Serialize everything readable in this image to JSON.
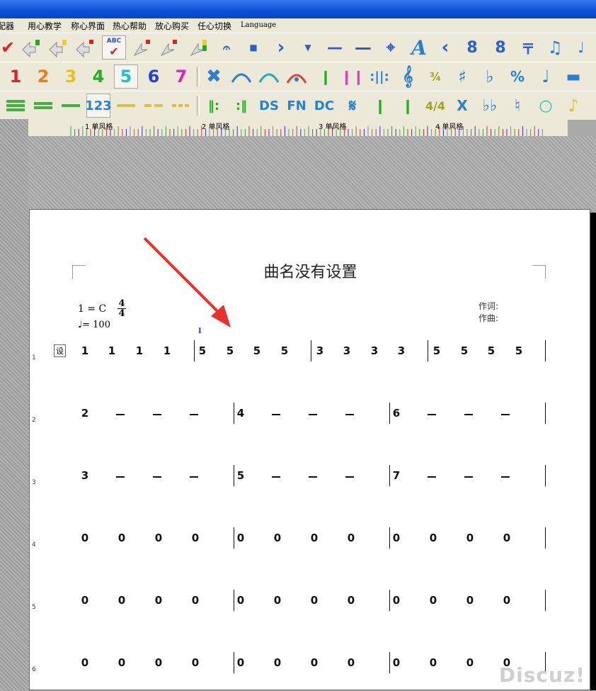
{
  "menu": [
    "配器",
    "用心教学",
    "称心界面",
    "热心帮助",
    "放心购买",
    "任心切换",
    "Language"
  ],
  "toolbar_row2_numbers": [
    "1",
    "2",
    "3",
    "4",
    "5",
    "6",
    "7"
  ],
  "toolbar_row3_text": {
    "ds": "DS",
    "fn": "FN",
    "dc": "DC",
    "x": "X",
    "abc": "ABC",
    "num123": "123"
  },
  "ruler_labels": [
    "1  单风格",
    "2  单风格",
    "3  单风格",
    "4  单风格"
  ],
  "score": {
    "title": "曲名没有设置",
    "key": "1 = C",
    "time_num": "4",
    "time_den": "4",
    "tempo": "= 100",
    "lyricist": "作词:",
    "composer": "作曲:",
    "set_button": "设",
    "cursor": "I",
    "line_numbers": [
      "1",
      "2",
      "3",
      "4",
      "5",
      "6"
    ],
    "line1": [
      "1",
      "1",
      "1",
      "1",
      "5",
      "5",
      "5",
      "5",
      "3",
      "3",
      "3",
      "3",
      "5",
      "5",
      "5",
      "5"
    ],
    "line2": [
      "2",
      "4",
      "6"
    ],
    "line3": [
      "3",
      "5",
      "7"
    ],
    "zero": "0"
  },
  "watermark": "Discuz!",
  "colors": {
    "title_blue": "#0a4fd6",
    "toolbar_bg": "#ece9d8",
    "arrow": "#e8322b"
  }
}
